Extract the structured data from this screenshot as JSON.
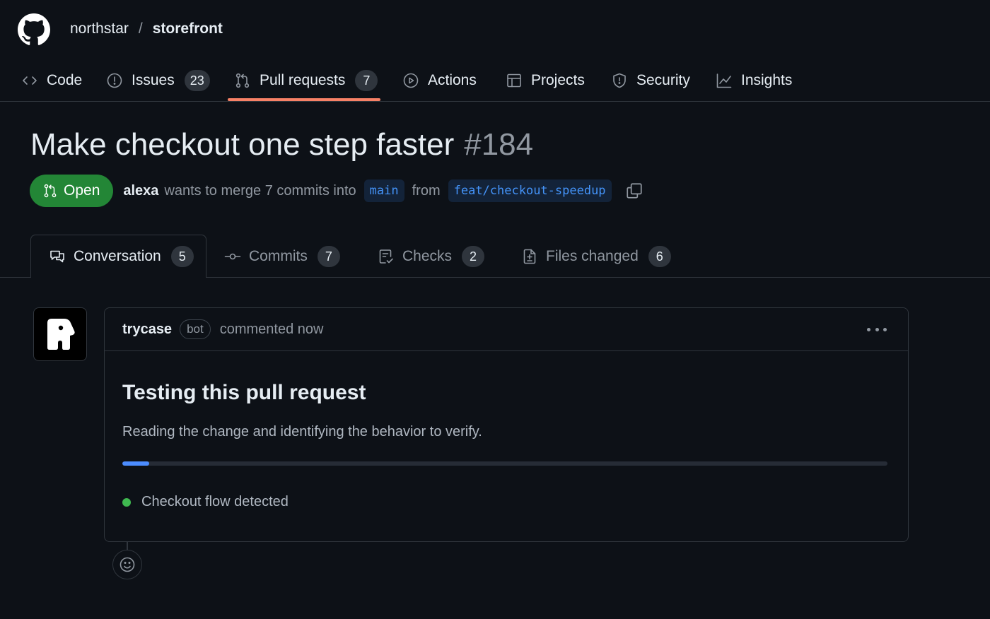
{
  "breadcrumb": {
    "owner": "northstar",
    "separator": "/",
    "repo": "storefront"
  },
  "repo_nav": {
    "code": {
      "label": "Code",
      "icon": "code-icon"
    },
    "issues": {
      "label": "Issues",
      "count": "23",
      "icon": "issue-opened-icon"
    },
    "pull_requests": {
      "label": "Pull requests",
      "count": "7",
      "icon": "git-pull-request-icon",
      "selected": true
    },
    "actions": {
      "label": "Actions",
      "icon": "play-icon"
    },
    "projects": {
      "label": "Projects",
      "icon": "table-icon"
    },
    "security": {
      "label": "Security",
      "icon": "shield-icon"
    },
    "insights": {
      "label": "Insights",
      "icon": "graph-icon"
    }
  },
  "pull_request": {
    "title": "Make checkout one step faster",
    "number": "#184",
    "state": "Open",
    "author": "alexa",
    "merge_text": "wants to merge 7 commits into",
    "base_branch": "main",
    "from_text": "from",
    "head_branch": "feat/checkout-speedup"
  },
  "pr_tabs": {
    "conversation": {
      "label": "Conversation",
      "count": "5",
      "selected": true
    },
    "commits": {
      "label": "Commits",
      "count": "7"
    },
    "checks": {
      "label": "Checks",
      "count": "2"
    },
    "files_changed": {
      "label": "Files changed",
      "count": "6"
    }
  },
  "comment": {
    "author": "trycase",
    "author_label": "bot",
    "timestamp_text": "commented now",
    "heading": "Testing this pull request",
    "text": "Reading the change and identifying the behavior to verify.",
    "progress_percent": 3.5,
    "status_item": "Checkout flow detected",
    "status_color": "#3fb950"
  },
  "colors": {
    "background": "#0d1117",
    "open_badge": "#238636",
    "selected_underline": "#f78166",
    "progress": "#4c8dff",
    "branch_text": "#4493f8"
  }
}
